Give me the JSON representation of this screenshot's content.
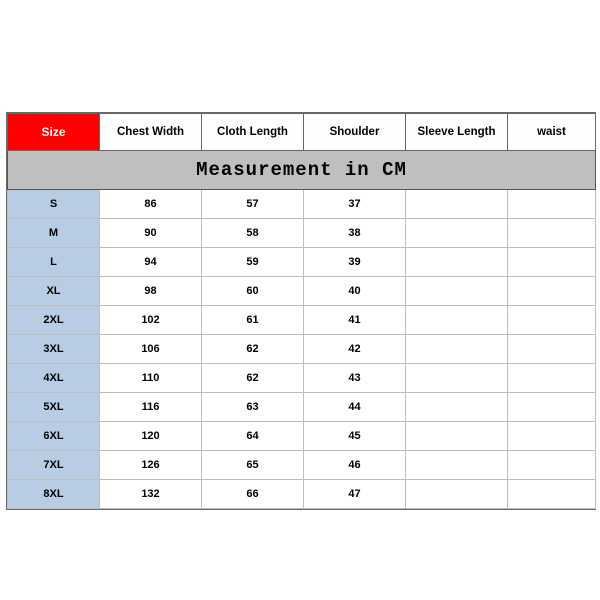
{
  "title": "Measurement in CM",
  "columns": {
    "size": "Size",
    "chest": "Chest Width",
    "cloth": "Cloth Length",
    "shoulder": "Shoulder",
    "sleeve": "Sleeve Length",
    "waist": "waist"
  },
  "rows": [
    {
      "size": "S",
      "chest": "86",
      "cloth": "57",
      "shoulder": "37",
      "sleeve": "",
      "waist": ""
    },
    {
      "size": "M",
      "chest": "90",
      "cloth": "58",
      "shoulder": "38",
      "sleeve": "",
      "waist": ""
    },
    {
      "size": "L",
      "chest": "94",
      "cloth": "59",
      "shoulder": "39",
      "sleeve": "",
      "waist": ""
    },
    {
      "size": "XL",
      "chest": "98",
      "cloth": "60",
      "shoulder": "40",
      "sleeve": "",
      "waist": ""
    },
    {
      "size": "2XL",
      "chest": "102",
      "cloth": "61",
      "shoulder": "41",
      "sleeve": "",
      "waist": ""
    },
    {
      "size": "3XL",
      "chest": "106",
      "cloth": "62",
      "shoulder": "42",
      "sleeve": "",
      "waist": ""
    },
    {
      "size": "4XL",
      "chest": "110",
      "cloth": "62",
      "shoulder": "43",
      "sleeve": "",
      "waist": ""
    },
    {
      "size": "5XL",
      "chest": "116",
      "cloth": "63",
      "shoulder": "44",
      "sleeve": "",
      "waist": ""
    },
    {
      "size": "6XL",
      "chest": "120",
      "cloth": "64",
      "shoulder": "45",
      "sleeve": "",
      "waist": ""
    },
    {
      "size": "7XL",
      "chest": "126",
      "cloth": "65",
      "shoulder": "46",
      "sleeve": "",
      "waist": ""
    },
    {
      "size": "8XL",
      "chest": "132",
      "cloth": "66",
      "shoulder": "47",
      "sleeve": "",
      "waist": ""
    }
  ],
  "chart_data": {
    "type": "table",
    "title": "Measurement in CM",
    "columns": [
      "Size",
      "Chest Width",
      "Cloth Length",
      "Shoulder",
      "Sleeve Length",
      "waist"
    ],
    "rows": [
      [
        "S",
        86,
        57,
        37,
        null,
        null
      ],
      [
        "M",
        90,
        58,
        38,
        null,
        null
      ],
      [
        "L",
        94,
        59,
        39,
        null,
        null
      ],
      [
        "XL",
        98,
        60,
        40,
        null,
        null
      ],
      [
        "2XL",
        102,
        61,
        41,
        null,
        null
      ],
      [
        "3XL",
        106,
        62,
        42,
        null,
        null
      ],
      [
        "4XL",
        110,
        62,
        43,
        null,
        null
      ],
      [
        "5XL",
        116,
        63,
        44,
        null,
        null
      ],
      [
        "6XL",
        120,
        64,
        45,
        null,
        null
      ],
      [
        "7XL",
        126,
        65,
        46,
        null,
        null
      ],
      [
        "8XL",
        132,
        66,
        47,
        null,
        null
      ]
    ]
  }
}
